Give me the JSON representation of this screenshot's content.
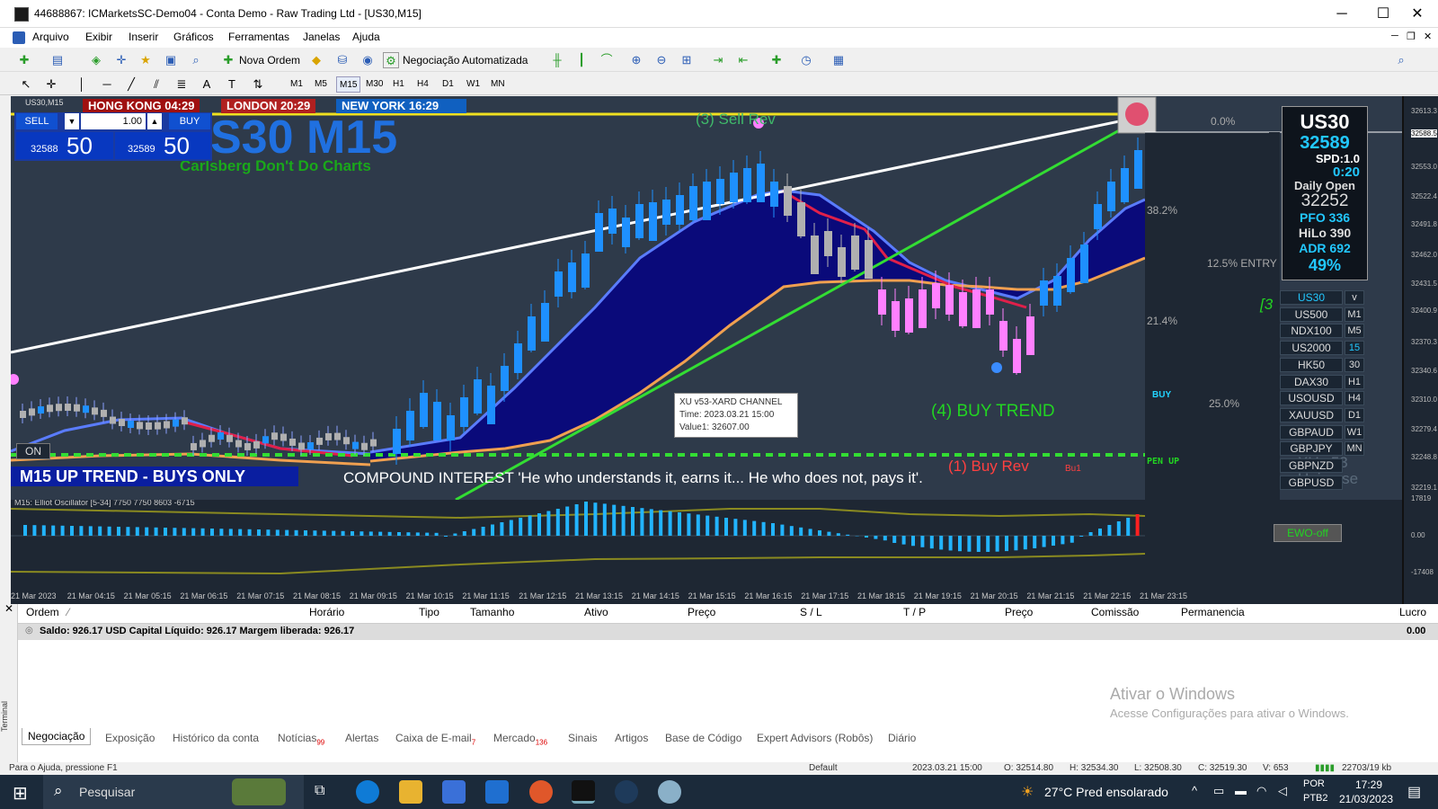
{
  "window": {
    "title": "44688867: ICMarketsSC-Demo04 - Conta Demo - Raw Trading Ltd - [US30,M15]"
  },
  "menu": [
    "Arquivo",
    "Exibir",
    "Inserir",
    "Gráficos",
    "Ferramentas",
    "Janelas",
    "Ajuda"
  ],
  "toolbar": {
    "new_order": "Nova Ordem",
    "auto_trading": "Negociação Automatizada"
  },
  "timeframes": [
    "M1",
    "M5",
    "M15",
    "M30",
    "H1",
    "H4",
    "D1",
    "W1",
    "MN"
  ],
  "chart": {
    "tab_label": "US30,M15",
    "sessions": {
      "hk": "HONG KONG 04:29",
      "london": "LONDON  20:29",
      "ny": "NEW YORK  16:29"
    },
    "big_title": "S30 M15",
    "subtitle": "Carlsberg Don't Do Charts",
    "trade": {
      "sell": "SELL",
      "buy": "BUY",
      "lot": "1.00",
      "sell_small": "32588",
      "sell_big": "50",
      "buy_small": "32589",
      "buy_big": "50"
    },
    "labels": {
      "sell_rev": "(3) Sell Rev",
      "buy_trend": "(4) BUY TREND",
      "buy_rev": "(1) Buy Rev",
      "buy_rev_small": "Bu1",
      "pen_up": "PEN UP",
      "buy": "BUY",
      "on": "ON",
      "uptrend": "M15 UP TREND - BUYS ONLY",
      "compound": "COMPOUND INTEREST  'He who understands it, earns it... He who does not, pays it'.",
      "pct0": "0.0%",
      "pct38": "38.2%",
      "pct125": "12.5% ENTRY",
      "pct21": "21.4%",
      "pct25": "25.0%",
      "side3": "[3",
      "watermark1": "XU v53",
      "watermark2": "Universe"
    },
    "tooltip": {
      "line1": "XU v53-XARD CHANNEL",
      "line2": "Time: 2023.03.21 15:00",
      "line3": "Value1: 32607.00"
    },
    "info": {
      "symbol": "US30",
      "price": "32589",
      "spd": "SPD:1.0",
      "time": "0:20",
      "daily_open_label": "Daily Open",
      "daily_open": "32252",
      "pfo": "PFO 336",
      "hilo": "HiLo 390",
      "adr": "ADR 692",
      "pct": "49%"
    },
    "symbols": [
      "US30",
      "US500",
      "NDX100",
      "US2000",
      "HK50",
      "DAX30",
      "USOUSD",
      "XAUUSD",
      "GBPAUD",
      "GBPJPY",
      "GBPNZD",
      "GBPUSD"
    ],
    "tf_side": [
      "v",
      "M1",
      "M5",
      "15",
      "30",
      "H1",
      "H4",
      "D1",
      "W1",
      "MN"
    ],
    "oscillator_label": "M15: Elliot Oscillator [5-34]  7750 7750 8603 -6715",
    "ewo_button": "EWO-off"
  },
  "price_axis": [
    "32613.3",
    "32588.5",
    "32553.0",
    "32522.4",
    "32491.8",
    "32462.0",
    "32431.5",
    "32400.9",
    "32370.3",
    "32340.6",
    "32310.0",
    "32279.4",
    "32248.8",
    "32219.1",
    "17819",
    "0.00",
    "-17408"
  ],
  "time_axis": [
    "21 Mar 2023",
    "21 Mar 04:15",
    "21 Mar 05:15",
    "21 Mar 06:15",
    "21 Mar 07:15",
    "21 Mar 08:15",
    "21 Mar 09:15",
    "21 Mar 10:15",
    "21 Mar 11:15",
    "21 Mar 12:15",
    "21 Mar 13:15",
    "21 Mar 14:15",
    "21 Mar 15:15",
    "21 Mar 16:15",
    "21 Mar 17:15",
    "21 Mar 18:15",
    "21 Mar 19:15",
    "21 Mar 20:15",
    "21 Mar 21:15",
    "21 Mar 22:15",
    "21 Mar 23:15"
  ],
  "terminal": {
    "columns": [
      "Ordem",
      "Horário",
      "Tipo",
      "Tamanho",
      "Ativo",
      "Preço",
      "S / L",
      "T / P",
      "Preço",
      "Comissão",
      "Permanencia",
      "Lucro"
    ],
    "balance": "Saldo: 926.17 USD  Capital Líquido: 926.17  Margem liberada: 926.17",
    "balance_profit": "0.00",
    "side_label": "Terminal",
    "tabs": [
      "Negociação",
      "Exposição",
      "Histórico da conta",
      "Notícias",
      "Alertas",
      "Caixa de E-mail",
      "Mercado",
      "Sinais",
      "Artigos",
      "Base de Código",
      "Expert Advisors (Robôs)",
      "Diário"
    ],
    "tab_badges": {
      "news": "99",
      "mail": "7",
      "market": "136"
    },
    "activate1": "Ativar o Windows",
    "activate2": "Acesse Configurações para ativar o Windows."
  },
  "status": {
    "help": "Para o Ajuda, pressione F1",
    "profile": "Default",
    "datetime": "2023.03.21 15:00",
    "o": "O: 32514.80",
    "h": "H: 32534.30",
    "l": "L: 32508.30",
    "c": "C: 32519.30",
    "v": "V: 653",
    "kb": "22703/19 kb"
  },
  "taskbar": {
    "search": "Pesquisar",
    "weather": "27°C  Pred ensolarado",
    "lang1": "POR",
    "lang2": "PTB2",
    "time": "17:29",
    "date": "21/03/2023"
  },
  "colors": {
    "chart_bg": "#2e3a4a",
    "bull": "#1e90ff",
    "bear": "#ff80ff",
    "trend_green": "#33dd33",
    "channel_fill": "#0a0a7a"
  }
}
